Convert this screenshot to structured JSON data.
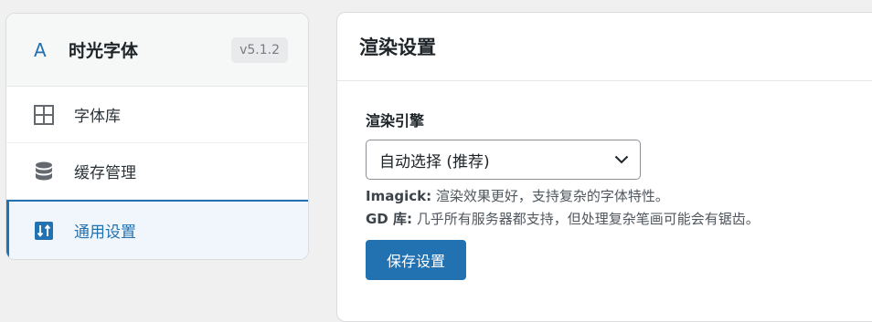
{
  "sidebar": {
    "brand_icon": "A",
    "brand_title": "时光字体",
    "version": "v5.1.2",
    "items": [
      {
        "label": "字体库",
        "icon": "grid-icon"
      },
      {
        "label": "缓存管理",
        "icon": "database-icon"
      },
      {
        "label": "通用设置",
        "icon": "sort-settings-icon",
        "active": true
      }
    ]
  },
  "main": {
    "title": "渲染设置",
    "engine_label": "渲染引擎",
    "engine_selected": "自动选择 (推荐)",
    "desc_imagick_key": "Imagick:",
    "desc_imagick_text": " 渲染效果更好，支持复杂的字体特性。",
    "desc_gd_key": "GD 库:",
    "desc_gd_text": " 几乎所有服务器都支持，但处理复杂笔画可能会有锯齿。",
    "save_label": "保存设置"
  },
  "colors": {
    "accent": "#2271b1",
    "active_bg": "#f0f6fc",
    "background": "#f0f0f1"
  }
}
